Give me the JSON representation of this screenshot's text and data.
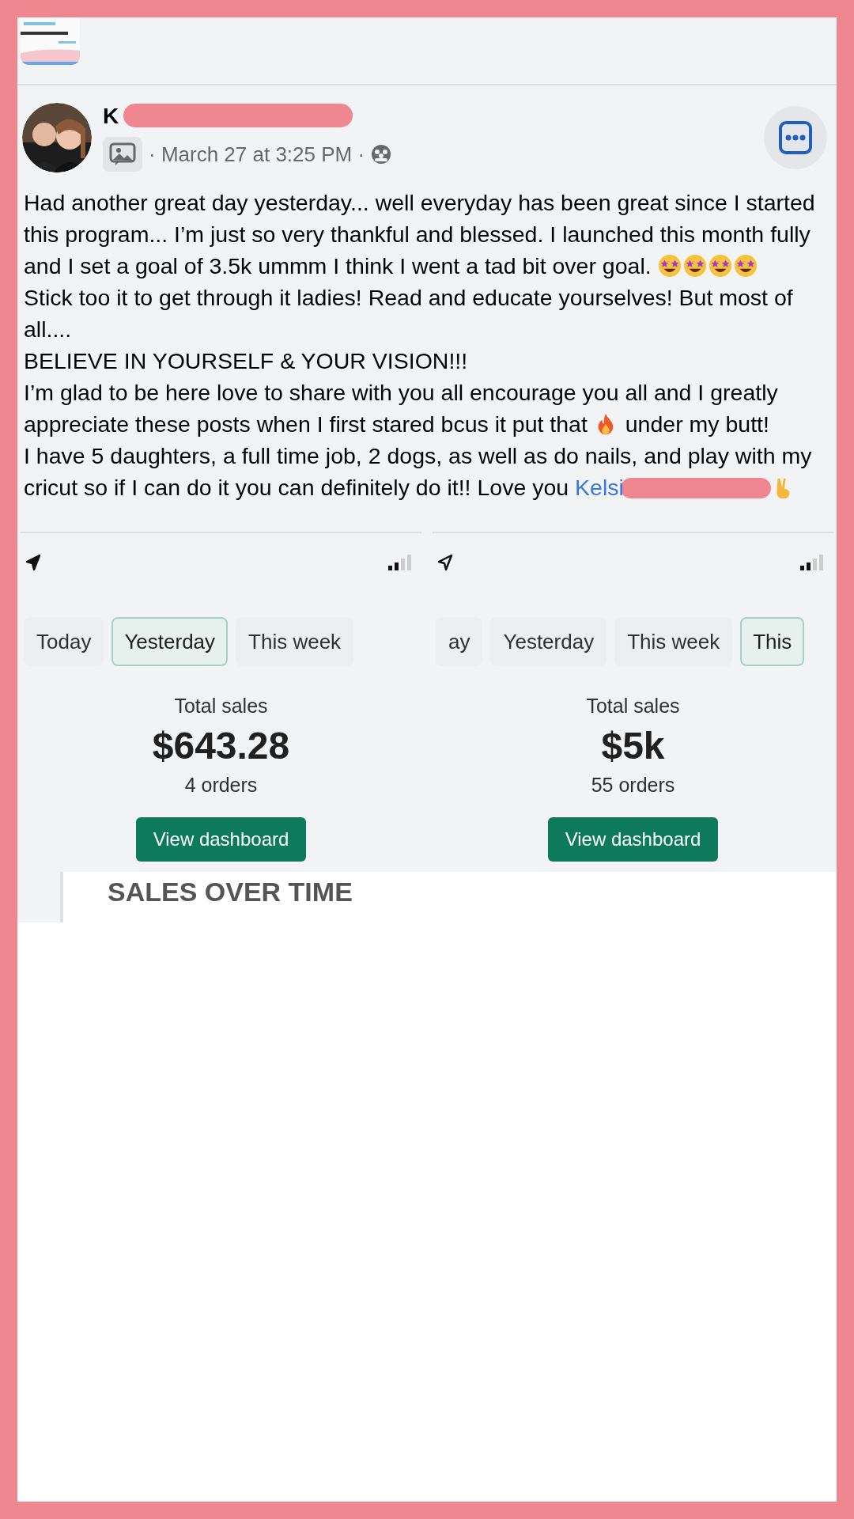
{
  "post": {
    "author": {
      "name": "K",
      "name_redacted": true
    },
    "meta": "· March 27 at 3:25 PM ·",
    "paragraphs": [
      [
        {
          "kind": "text",
          "text": "Had another great day yesterday... well everyday has been great since I started this program... I’m just so very thankful and blessed. I launched this month fully and I set a goal of 3.5k ummm I think I went a tad bit over goal. "
        },
        {
          "kind": "star-struck"
        },
        {
          "kind": "star-struck"
        },
        {
          "kind": "star-struck"
        },
        {
          "kind": "star-struck"
        }
      ],
      [
        {
          "kind": "text",
          "text": "Stick too it to get through it ladies! Read and educate yourselves! But most of all...."
        }
      ],
      [
        {
          "kind": "text",
          "text": "BELIEVE IN YOURSELF & YOUR VISION!!!"
        }
      ],
      [
        {
          "kind": "text",
          "text": "I’m glad to be here love to share with you all encourage you all and I greatly appreciate these posts when I first stared bcus it put that "
        },
        {
          "kind": "fire"
        },
        {
          "kind": "text",
          "text": " under my butt!"
        }
      ],
      [
        {
          "kind": "text",
          "text": "I have 5 daughters, a full time job, 2 dogs, as well as do nails, and play with my cricut so if I can do it you can definitely do it!! Love you "
        },
        {
          "kind": "link",
          "text": "Kelsi",
          "redacted": true
        },
        {
          "kind": "peace"
        }
      ]
    ]
  },
  "screenshots": [
    {
      "tabs": [
        {
          "label": "Today",
          "selected": false
        },
        {
          "label": "Yesterday",
          "selected": true
        },
        {
          "label": "This week",
          "selected": false
        }
      ],
      "title": "Total sales",
      "amount": "$643.28",
      "orders": "4 orders",
      "button": "View dashboard"
    },
    {
      "tabs": [
        {
          "label": "ay",
          "selected": false
        },
        {
          "label": "Yesterday",
          "selected": false
        },
        {
          "label": "This week",
          "selected": false
        },
        {
          "label": "This",
          "selected": true
        }
      ],
      "title": "Total sales",
      "amount": "$5k",
      "orders": "55 orders",
      "button": "View dashboard"
    }
  ],
  "report": {
    "title": "SALES OVER TIME"
  }
}
